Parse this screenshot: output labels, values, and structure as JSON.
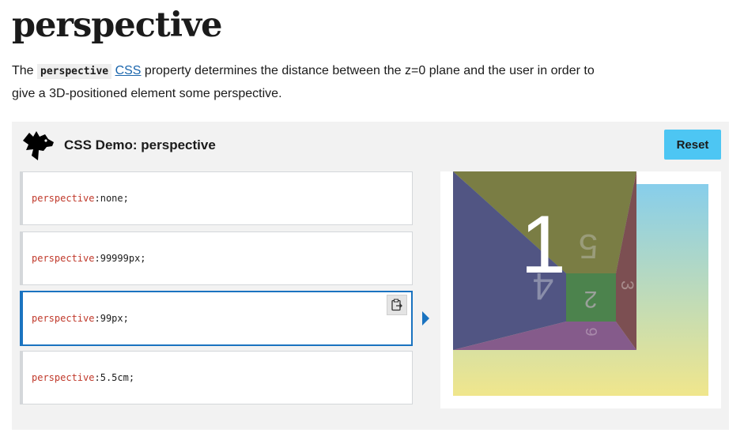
{
  "page": {
    "title": "perspective",
    "intro": {
      "before": "The ",
      "code": "perspective",
      "link": "CSS",
      "after": " property determines the distance between the z=0 plane and the user in order to give a 3D-positioned element some perspective."
    }
  },
  "demo": {
    "title": "CSS Demo: perspective",
    "reset_label": "Reset",
    "choices": [
      {
        "prop": "perspective",
        "sep": ": ",
        "value": "none;"
      },
      {
        "prop": "perspective",
        "sep": ": ",
        "value": "99999px;"
      },
      {
        "prop": "perspective",
        "sep": ": ",
        "value": "99px;"
      },
      {
        "prop": "perspective",
        "sep": ": ",
        "value": "5.5cm;"
      }
    ],
    "selected_index": 2,
    "cube_faces": {
      "front": "1",
      "back": "2",
      "right": "3",
      "left": "4",
      "top": "5",
      "bottom": "6"
    },
    "colors": {
      "accent": "#1a73c0",
      "reset_bg": "#4dc6f3",
      "property": "#c0392b"
    }
  }
}
